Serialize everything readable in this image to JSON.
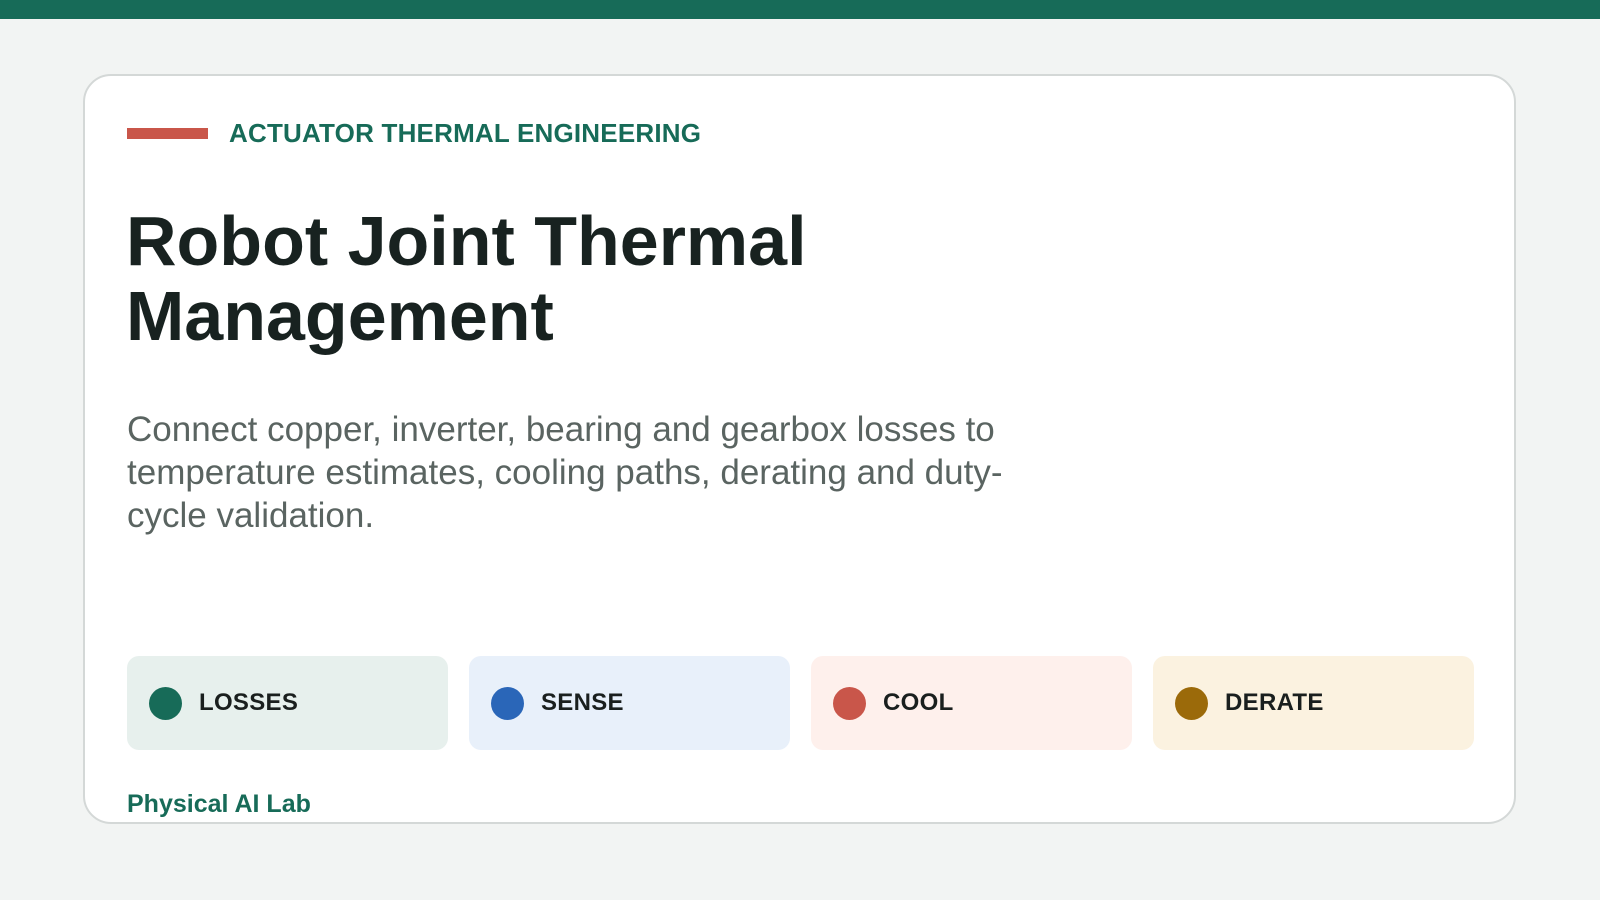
{
  "header": {
    "eyebrow": "ACTUATOR THERMAL ENGINEERING"
  },
  "title": "Robot Joint Thermal Management",
  "subtitle": "Connect copper, inverter, bearing and gearbox losses to temperature estimates, cooling paths, derating and duty-cycle validation.",
  "tiles": [
    {
      "label": "LOSSES",
      "dot_color": "#176b58",
      "bg_color": "#e7f0ed"
    },
    {
      "label": "SENSE",
      "dot_color": "#2a66b8",
      "bg_color": "#e8f0fa"
    },
    {
      "label": "COOL",
      "dot_color": "#c9564a",
      "bg_color": "#fef0ec"
    },
    {
      "label": "DERATE",
      "dot_color": "#9b6a0a",
      "bg_color": "#fbf2e0"
    }
  ],
  "footer": "Physical AI Lab",
  "colors": {
    "brand": "#176b58",
    "accent": "#c9564a",
    "background": "#f2f4f3"
  }
}
